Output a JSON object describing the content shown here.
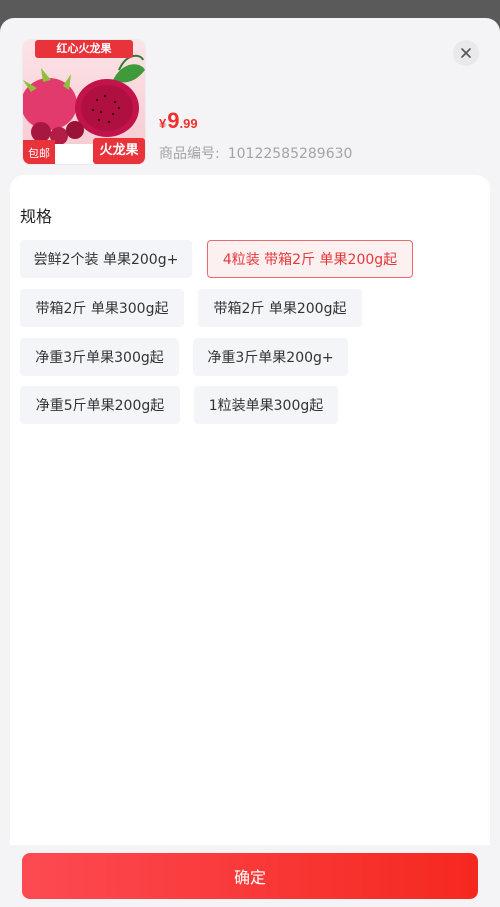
{
  "product": {
    "image_banner": "红心火龙果",
    "image_badge_left": "包邮",
    "image_badge_right": "火龙果",
    "price_currency": "¥",
    "price_integer": "9",
    "price_decimal": ".99",
    "sku_label": "商品编号:",
    "sku_value": "10122585289630"
  },
  "spec": {
    "title": "规格",
    "options": [
      {
        "label": "尝鲜2个装 单果200g+",
        "selected": false
      },
      {
        "label": "4粒装 带箱2斤 单果200g起",
        "selected": true
      },
      {
        "label": "带箱2斤 单果300g起",
        "selected": false
      },
      {
        "label": "带箱2斤 单果200g起",
        "selected": false
      },
      {
        "label": "净重3斤单果300g起",
        "selected": false
      },
      {
        "label": "净重3斤单果200g+",
        "selected": false
      },
      {
        "label": "净重5斤单果200g起",
        "selected": false
      },
      {
        "label": "1粒装单果300g起",
        "selected": false
      }
    ]
  },
  "footer": {
    "confirm_label": "确定"
  },
  "colors": {
    "accent": "#f0302b",
    "selected_border": "#ea6a6e",
    "selected_bg": "#fdf0f0"
  }
}
